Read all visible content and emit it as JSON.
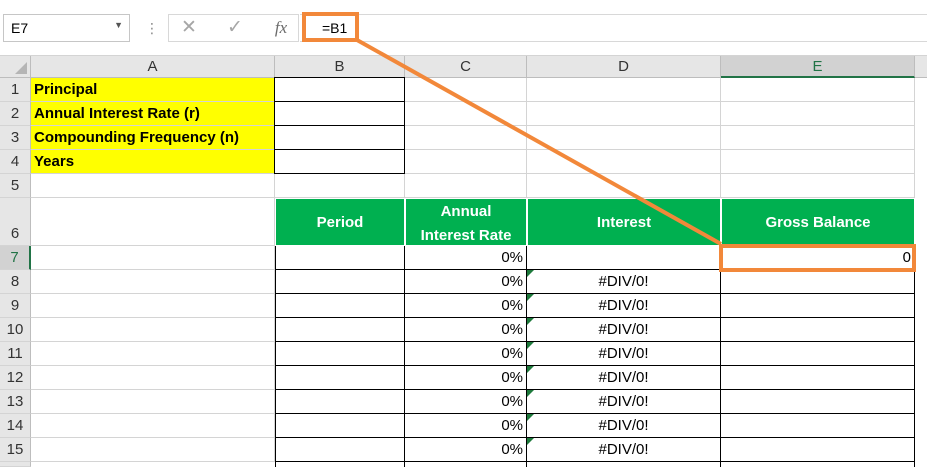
{
  "formula_bar": {
    "name_box": "E7",
    "name_box_icon": "chevron-down-icon",
    "cancel_icon": "close-icon",
    "enter_icon": "check-icon",
    "fx_label": "fx",
    "formula": "=B1"
  },
  "columns": [
    "A",
    "B",
    "C",
    "D",
    "E"
  ],
  "selected_column": "E",
  "rows": [
    "1",
    "2",
    "3",
    "4",
    "5",
    "6",
    "7",
    "8",
    "9",
    "10",
    "11",
    "12",
    "13",
    "14",
    "15"
  ],
  "selected_row": "7",
  "inputs": {
    "principal": "Principal",
    "rate": "Annual Interest Rate (r)",
    "frequency": "Compounding Frequency (n)",
    "years": "Years"
  },
  "table_header": {
    "period": "Period",
    "annual_rate_line1": "Annual",
    "annual_rate_line2": "Interest Rate",
    "interest": "Interest",
    "gross_balance": "Gross Balance"
  },
  "table_rows": [
    {
      "row": "7",
      "rate": "0%",
      "interest": "",
      "balance": "0"
    },
    {
      "row": "8",
      "rate": "0%",
      "interest": "#DIV/0!",
      "balance": ""
    },
    {
      "row": "9",
      "rate": "0%",
      "interest": "#DIV/0!",
      "balance": ""
    },
    {
      "row": "10",
      "rate": "0%",
      "interest": "#DIV/0!",
      "balance": ""
    },
    {
      "row": "11",
      "rate": "0%",
      "interest": "#DIV/0!",
      "balance": ""
    },
    {
      "row": "12",
      "rate": "0%",
      "interest": "#DIV/0!",
      "balance": ""
    },
    {
      "row": "13",
      "rate": "0%",
      "interest": "#DIV/0!",
      "balance": ""
    },
    {
      "row": "14",
      "rate": "0%",
      "interest": "#DIV/0!",
      "balance": ""
    },
    {
      "row": "15",
      "rate": "0%",
      "interest": "#DIV/0!",
      "balance": ""
    }
  ],
  "colors": {
    "input_fill": "#ffff00",
    "header_fill": "#00b050",
    "highlight": "#f2883a",
    "selection": "#217346"
  }
}
